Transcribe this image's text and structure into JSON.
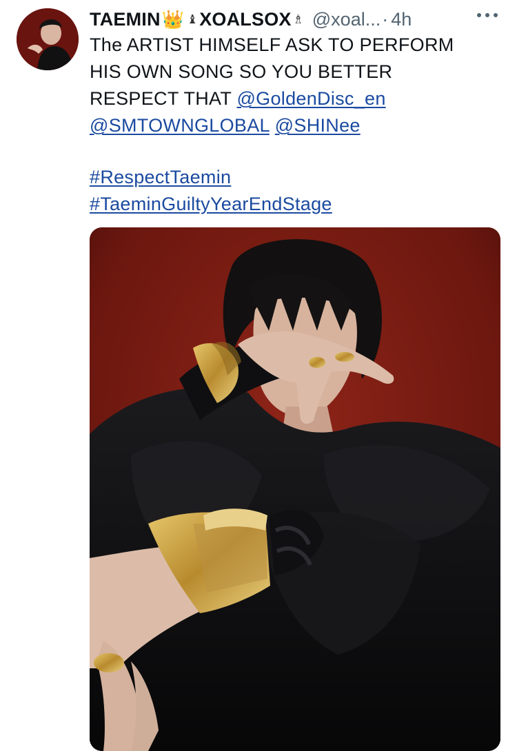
{
  "tweet": {
    "author": {
      "display_name_part1": "TAEMIN",
      "display_name_part2": "XOALSOX",
      "crown_emoji": "👑",
      "chess_emoji_1": "♝",
      "chess_emoji_2": "♗",
      "handle": "@xoal...",
      "dot": "·",
      "time": "4h"
    },
    "text": {
      "line1": "The ARTIST HIMSELF ASK TO PERFORM",
      "line2": "HIS  OWN SONG SO YOU BETTER",
      "line3_prefix": "RESPECT THAT ",
      "mention_golden": "@GoldenDisc_en",
      "mention_smtown": "@SMTOWNGLOBAL",
      "mention_shinee": "@SHINee",
      "hashtag_respect": "#RespectTaemin",
      "hashtag_guilty": "#TaeminGuiltyYearEndStage"
    }
  },
  "colors": {
    "link": "#1a4aa0",
    "secondary_text": "#536471",
    "photo_background": "#7a1c14",
    "jacket": "#0e0e10",
    "gold": "#c9a247"
  },
  "icons": {
    "more": "more-horizontal-icon"
  }
}
